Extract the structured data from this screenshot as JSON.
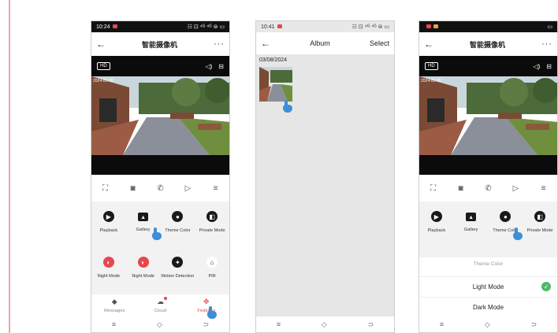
{
  "phone1": {
    "status_time": "10:24",
    "status_right": "☷ ⊡ ⁴ᴳ ⁴ᴳ ⊜ ▭",
    "title": "智能摄像机",
    "back_icon": "←",
    "more_icon": "···",
    "hd_label": "HD",
    "video_timestamp": "2024-03-08",
    "features_row1": [
      "Playback",
      "Gallery",
      "Theme Color",
      "Private Mode"
    ],
    "features_row2": [
      "Night Mode",
      "Night Mode",
      "Motion Detection",
      "PIR"
    ],
    "tabs": [
      "Messages",
      "Cloud",
      "Features"
    ]
  },
  "phone2": {
    "status_time": "10:41",
    "status_right": "☷ ⊡ ⁴ᴳ ⁴ᴳ ⊜ ▭",
    "back_icon": "←",
    "title": "Album",
    "select_label": "Select",
    "date_label": "03/08/2024"
  },
  "phone3": {
    "status_right": "▭",
    "title": "智能摄像机",
    "back_icon": "←",
    "more_icon": "···",
    "hd_label": "HD",
    "video_timestamp": "2024-03-08",
    "features_row1": [
      "Playback",
      "Gallery",
      "Theme Color",
      "Private Mode"
    ],
    "sheet_title": "Theme Color",
    "option_light": "Light Mode",
    "option_dark": "Dark Mode"
  },
  "colors": {
    "accent": "#e5484d",
    "check": "#4cbb6a",
    "hand": "#3b8fd9"
  }
}
